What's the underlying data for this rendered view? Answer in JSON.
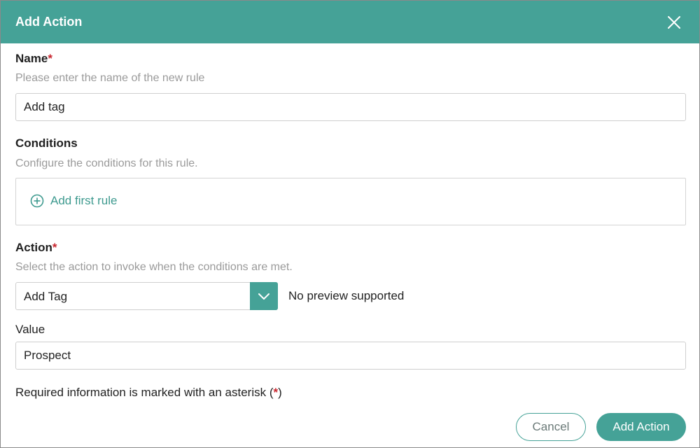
{
  "dialog": {
    "title": "Add Action",
    "close_icon": "close-icon"
  },
  "name": {
    "label": "Name",
    "required_mark": "*",
    "hint": "Please enter the name of the new rule",
    "value": "Add tag"
  },
  "conditions": {
    "label": "Conditions",
    "hint": "Configure the conditions for this rule.",
    "add_rule_icon": "plus-circle-icon",
    "add_rule_label": "Add first rule"
  },
  "action": {
    "label": "Action",
    "required_mark": "*",
    "hint": "Select the action to invoke when the conditions are met.",
    "selected": "Add Tag",
    "dropdown_icon": "chevron-down-icon",
    "preview_text": "No preview supported"
  },
  "value_field": {
    "label": "Value",
    "value": "Prospect"
  },
  "footnote": {
    "text_before": "Required information is marked with an asterisk (",
    "mark": "*",
    "text_after": ")"
  },
  "buttons": {
    "cancel": "Cancel",
    "submit": "Add Action"
  },
  "colors": {
    "accent": "#45a297",
    "required": "#c8272f",
    "hint": "#9a9a9a"
  }
}
